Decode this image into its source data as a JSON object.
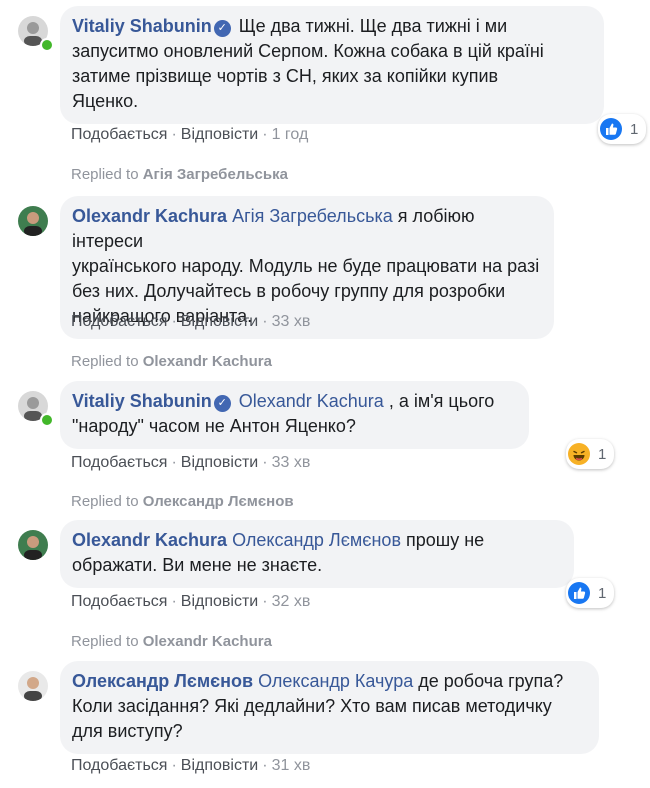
{
  "comments": [
    {
      "author": "Vitaliy Shabunin",
      "verified": true,
      "online": true,
      "mention": "",
      "lines": [
        "Ще два тижні. Ще два тижні і ми",
        "запуситмо оновлений Серпом. Кожна собака в цій країні",
        "затиме прізвище чортів з СН, яких за копійки купив",
        "Яценко."
      ],
      "like_label": "Подобається",
      "reply_label": "Відповісти",
      "time": "1 год",
      "reaction": {
        "type": "like",
        "count": "1"
      }
    },
    {
      "replied_to_prefix": "Replied to",
      "replied_to": "Агія Загребельська",
      "author": "Olexandr Kachura",
      "verified": false,
      "online": false,
      "mention": "Агія Загребельська",
      "lines": [
        "я лобіюю інтереси",
        "українського народу. Модуль не буде працювати на разі",
        "без них. Долучайтесь в робочу группу для розробки",
        "найкращого варіанта."
      ],
      "like_label": "Подобається",
      "reply_label": "Відповісти",
      "time": "33 хв"
    },
    {
      "replied_to_prefix": "Replied to",
      "replied_to": "Olexandr Kachura",
      "author": "Vitaliy Shabunin",
      "verified": true,
      "online": true,
      "mention": "Olexandr Kachura",
      "lines": [
        ", а ім'я цього",
        "\"народу\" часом не Антон Яценко?"
      ],
      "like_label": "Подобається",
      "reply_label": "Відповісти",
      "time": "33 хв",
      "reaction": {
        "type": "haha",
        "count": "1"
      }
    },
    {
      "replied_to_prefix": "Replied to",
      "replied_to": "Олександр Лємєнов",
      "author": "Olexandr Kachura",
      "verified": false,
      "online": false,
      "mention": "Олександр Лємєнов",
      "lines": [
        "прошу не",
        "ображати. Ви мене не знаєте."
      ],
      "like_label": "Подобається",
      "reply_label": "Відповісти",
      "time": "32 хв",
      "reaction": {
        "type": "like",
        "count": "1"
      }
    },
    {
      "replied_to_prefix": "Replied to",
      "replied_to": "Olexandr Kachura",
      "author": "Олександр Лємєнов",
      "verified": false,
      "online": false,
      "mention": "Олександр Качура",
      "lines": [
        "де робоча група?",
        "Коли засідання? Які дедлайни? Хто вам писав методичку",
        "для виступу?"
      ],
      "like_label": "Подобається",
      "reply_label": "Відповісти",
      "time": "31 хв"
    }
  ]
}
